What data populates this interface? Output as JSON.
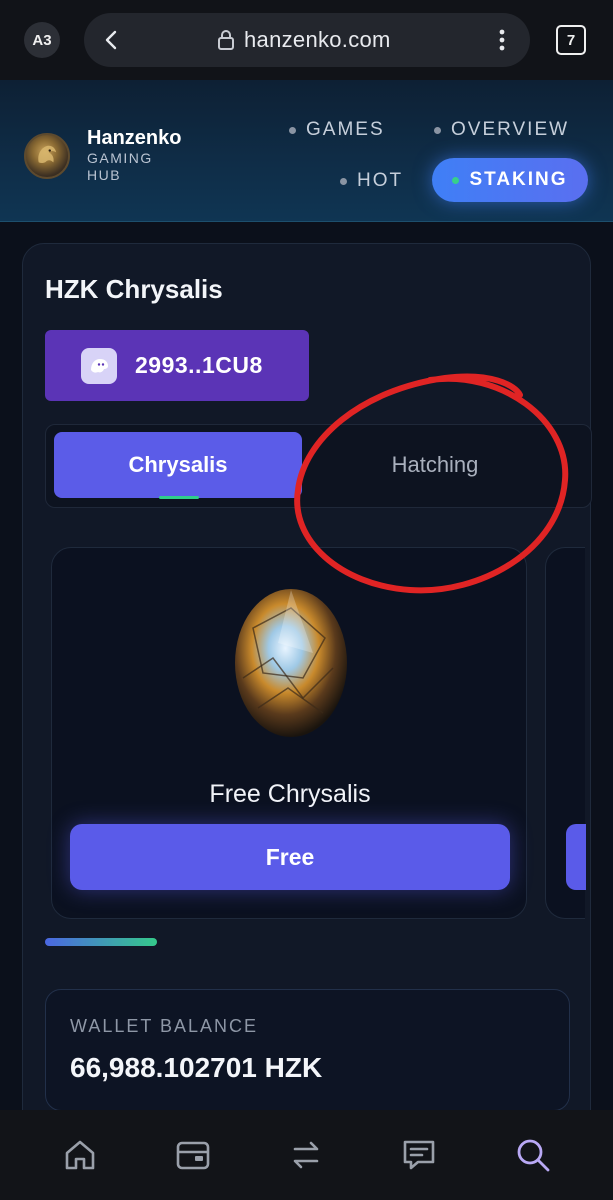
{
  "browser": {
    "profile": "A3",
    "url": "hanzenko.com",
    "tab_count": "7"
  },
  "header": {
    "brand_name": "Hanzenko",
    "brand_sub": "GAMING HUB",
    "nav": {
      "games": "GAMES",
      "overview": "OVERVIEW",
      "hot": "HOT",
      "staking": "STAKING"
    }
  },
  "main": {
    "title": "HZK Chrysalis",
    "wallet_address": "2993..1CU8",
    "tabs": {
      "chrysalis": "Chrysalis",
      "hatching": "Hatching"
    },
    "product": {
      "name": "Free Chrysalis",
      "button": "Free"
    },
    "balance": {
      "label": "WALLET BALANCE",
      "value": "66,988.102701 HZK"
    }
  },
  "colors": {
    "accent": "#5b5ce8",
    "wallet": "#5b34b6",
    "staking": "#3f7ff6",
    "annotation": "#e02424"
  },
  "icons": {
    "bottom_nav": [
      "home-icon",
      "wallet-icon",
      "swap-icon",
      "chat-icon",
      "search-icon"
    ]
  }
}
